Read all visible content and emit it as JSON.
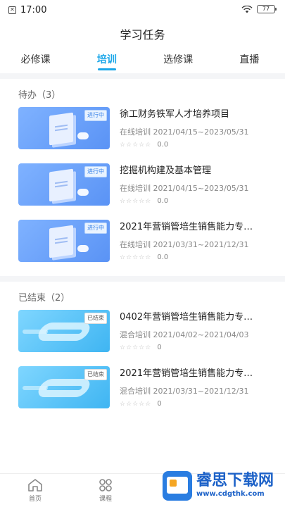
{
  "status_bar": {
    "time": "17:00",
    "battery": "77"
  },
  "header": {
    "title": "学习任务"
  },
  "tabs": [
    {
      "label": "必修课"
    },
    {
      "label": "培训"
    },
    {
      "label": "选修课"
    },
    {
      "label": "直播"
    }
  ],
  "active_tab": "培训",
  "sections": [
    {
      "title": "待办（3）",
      "courses": [
        {
          "title": "徐工财务铁军人才培养项目",
          "meta": "在线培训 2021/04/15~2023/05/31",
          "rating": "0.0",
          "badge": "进行中"
        },
        {
          "title": "挖掘机构建及基本管理",
          "meta": "在线培训 2021/04/15~2023/05/31",
          "rating": "0.0",
          "badge": "进行中"
        },
        {
          "title": "2021年营销管培生销售能力专…",
          "meta": "在线培训 2021/03/31~2021/12/31",
          "rating": "0.0",
          "badge": "进行中"
        }
      ]
    },
    {
      "title": "已结束（2）",
      "courses": [
        {
          "title": "0402年营销管培生销售能力专…",
          "meta": "混合培训 2021/04/02~2021/04/03",
          "rating": "0",
          "badge": "已结束"
        },
        {
          "title": "2021年营销管培生销售能力专…",
          "meta": "混合培训 2021/03/31~2021/12/31",
          "rating": "0",
          "badge": "已结束"
        }
      ]
    }
  ],
  "bottom_nav": [
    {
      "label": "首页",
      "icon": "home-icon"
    },
    {
      "label": "课程",
      "icon": "grid-icon"
    }
  ],
  "watermark": {
    "name": "睿思下载网",
    "url": "www.cdgthk.com"
  },
  "colors": {
    "accent": "#1aa6e8"
  }
}
